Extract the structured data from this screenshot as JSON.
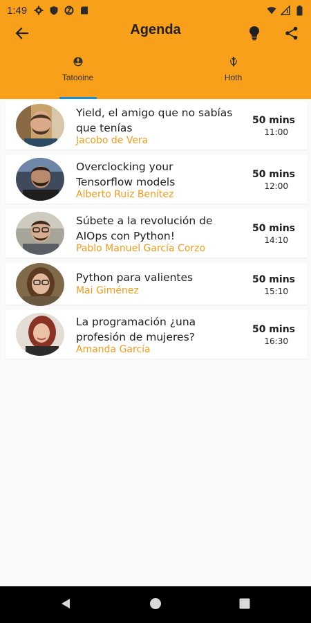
{
  "status_bar": {
    "time": "1:49",
    "left_icons": [
      "settings-icon",
      "shield-icon",
      "data-saver-icon",
      "sd-card-icon"
    ],
    "right_icons": [
      "wifi-icon",
      "cell-signal-icon",
      "battery-icon"
    ]
  },
  "app_bar": {
    "title": "Agenda",
    "color": "#f9a01b",
    "back_icon": "arrow-back-icon",
    "bulb_icon": "lightbulb-icon",
    "share_icon": "share-icon"
  },
  "tabs": [
    {
      "label": "Tatooine",
      "icon": "rebel-icon",
      "selected": true
    },
    {
      "label": "Hoth",
      "icon": "jedi-icon",
      "selected": false
    }
  ],
  "talks": [
    {
      "title_lines": [
        "Yield, el amigo que no sabías",
        "que tenías"
      ],
      "speaker": "Jacobo de Vera",
      "duration": "50 mins",
      "time": "11:00"
    },
    {
      "title_lines": [
        "Overclocking your",
        "Tensorflow models"
      ],
      "speaker": "Alberto Ruiz Benítez",
      "duration": "50 mins",
      "time": "12:00"
    },
    {
      "title_lines": [
        "Súbete a la revolución de",
        "AIOps con Python!"
      ],
      "speaker": "Pablo Manuel García Corzo",
      "duration": "50 mins",
      "time": "14:10"
    },
    {
      "title_lines": [
        "Python para valientes"
      ],
      "speaker": "Mai Giménez",
      "duration": "50 mins",
      "time": "15:10"
    },
    {
      "title_lines": [
        "La programación ¿una",
        "profesión de mujeres?"
      ],
      "speaker": "Amanda García",
      "duration": "50 mins",
      "time": "16:30"
    }
  ],
  "nav_bar": {
    "back": "nav-back-icon",
    "home": "nav-home-icon",
    "recents": "nav-recents-icon"
  }
}
